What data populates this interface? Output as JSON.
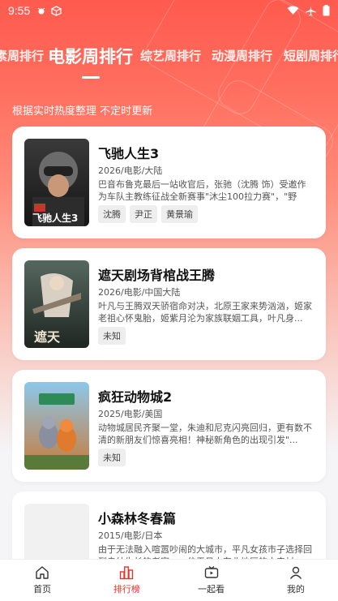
{
  "status_bar": {
    "time": "9:55"
  },
  "tabs": [
    {
      "label": "素周排行",
      "active": false
    },
    {
      "label": "电影周排行",
      "active": true
    },
    {
      "label": "综艺周排行",
      "active": false
    },
    {
      "label": "动漫周排行",
      "active": false
    },
    {
      "label": "短剧周排行",
      "active": false
    }
  ],
  "subtitle": "根据实时热度整理 不定时更新",
  "items": [
    {
      "title": "飞驰人生3",
      "meta": "2026/电影/大陆",
      "desc": "巴音布鲁克最后一站收官后，张驰（沈腾 饰）受邀作为车队主教练征战全新赛事\"沐尘100拉力赛\"，\"野生...",
      "tags": [
        "沈腾",
        "尹正",
        "黄景瑜"
      ],
      "poster_colors": [
        "#2a2a2a",
        "#c0392b"
      ]
    },
    {
      "title": "遮天剧场背棺战王腾",
      "meta": "2026/电影/中国大陆",
      "desc": "叶凡与王腾双天骄宿命对决，北原王家来势汹汹，姬家老祖心怀鬼胎，姬紫月沦为家族联姻工具，叶凡身...",
      "tags": [
        "未知"
      ],
      "poster_colors": [
        "#3b4a44",
        "#d9cfc0"
      ]
    },
    {
      "title": "疯狂动物城2",
      "meta": "2025/电影/美国",
      "desc": "动物城居民齐聚一堂，朱迪和尼克闪亮回归，更有数不清的新朋友们惊喜亮相！神秘新角色的出现引发\"...",
      "tags": [
        "未知"
      ],
      "poster_colors": [
        "#6fb0d8",
        "#e58a3a"
      ]
    },
    {
      "title": "小森林冬春篇",
      "meta": "2015/电影/日本",
      "desc": "由于无法融入喧嚣吵闹的大城市，平凡女孩市子选择回到自幼生长的老家——位于日本东北地区的小森村...",
      "tags": [],
      "poster_colors": [
        "#f0f0f0",
        "#f0f0f0"
      ]
    }
  ],
  "bottom_nav": [
    {
      "label": "首页",
      "icon": "home-icon",
      "active": false
    },
    {
      "label": "排行榜",
      "icon": "ranking-icon",
      "active": true
    },
    {
      "label": "一起看",
      "icon": "tv-icon",
      "active": false
    },
    {
      "label": "我的",
      "icon": "profile-icon",
      "active": false
    }
  ],
  "colors": {
    "accent": "#e8322a",
    "hero_top": "#ff5a4e"
  }
}
